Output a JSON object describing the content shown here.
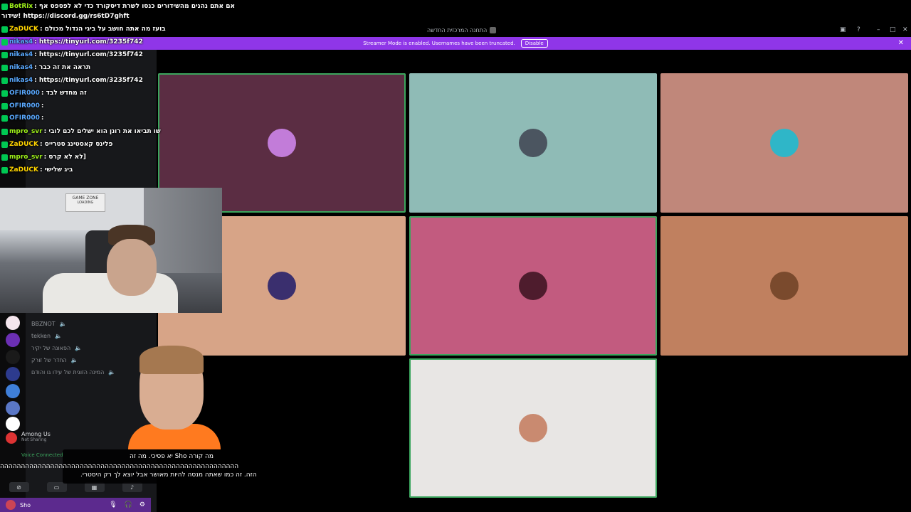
{
  "window": {
    "title": "התחנה המרכזית החדשה"
  },
  "banner": {
    "text": "Streamer Mode is enabled. Usernames have been truncated.",
    "disable_label": "Disable"
  },
  "chat": [
    {
      "user": "BotRix",
      "text": ": אם אתם נהנים מהשידורים כנסו לשרת דיסקורד כדי לא לפספס אף",
      "color": "green"
    },
    {
      "user": "",
      "text": "שידור! https://discord.gg/rs6tD7ghft",
      "color": "none"
    },
    {
      "user": "ZaDUCK",
      "text": ": בועז מה אתה חושב על ביגי הגדול מכולם",
      "color": "yellow"
    },
    {
      "user": "nikas4",
      "text": ": https://tinyurl.com/3235f742",
      "color": "blue"
    },
    {
      "user": "nikas4",
      "text": ": https://tinyurl.com/3235f742",
      "color": "blue"
    },
    {
      "user": "nikas4",
      "text": ": תראה את זה כבר",
      "color": "blue"
    },
    {
      "user": "nikas4",
      "text": ": https://tinyurl.com/3235f742",
      "color": "blue"
    },
    {
      "user": "OFIR000",
      "text": ": זה מחדש לבד",
      "color": "blue"
    },
    {
      "user": "OFIR000",
      "text": ":",
      "color": "blue"
    },
    {
      "user": "OFIR000",
      "text": ":",
      "color": "blue"
    },
    {
      "user": "mpro_svr",
      "text": ": שו תביאו את רונן הוא ישלים לכם לובי",
      "color": "green"
    },
    {
      "user": "ZaDUCK",
      "text": ": פלינס קאסטינג סטרייס",
      "color": "yellow"
    },
    {
      "user": "mpro_svr",
      "text": ": לא לא קרס]",
      "color": "green"
    },
    {
      "user": "ZaDUCK",
      "text": ": ביג שלישי",
      "color": "yellow"
    }
  ],
  "voice_channels": [
    "BBZNOT",
    "tekken",
    "הפאונה של יקיר",
    "החדר של זורק",
    "המינה הזוגית של עידו גו והודם"
  ],
  "among_us": {
    "title": "Among Us",
    "status": "Not Sharing"
  },
  "voice_connected": "Voice Connected",
  "user": {
    "name": "Sho"
  },
  "subtitles": {
    "line1": "מה קורה Sho יא פסיכי. מה זה",
    "line2": "ההההההההההההההההההההההההההההההההההההההההההההההההההההההההה",
    "line3": "הזה. זה כמו שאתה מנסה להיות מאושר אבל יוצא לך רק היסטרי."
  },
  "webcam": {
    "sign_text": "GAME ZONE",
    "sign_sub": "LOADING"
  },
  "tiles": [
    {
      "name": "tile-1",
      "color": "#5b2d43",
      "speaking": true,
      "avatar": "#c27cd9"
    },
    {
      "name": "tile-2",
      "color": "#8fbbb6",
      "speaking": false,
      "avatar": "#4b5560"
    },
    {
      "name": "tile-3",
      "color": "#c0877a",
      "speaking": false,
      "avatar": "#2fb6c8"
    },
    {
      "name": "tile-4",
      "color": "#d7a487",
      "speaking": false,
      "avatar": "#3a2f6e"
    },
    {
      "name": "tile-5",
      "color": "#c25b7f",
      "speaking": true,
      "avatar": "#4e1c2d"
    },
    {
      "name": "tile-6",
      "color": "#c0805f",
      "speaking": false,
      "avatar": "#7a4a2d"
    },
    {
      "name": "tile-7",
      "color": "#e8e6e4",
      "speaking": true,
      "avatar": "#c98a70"
    }
  ]
}
